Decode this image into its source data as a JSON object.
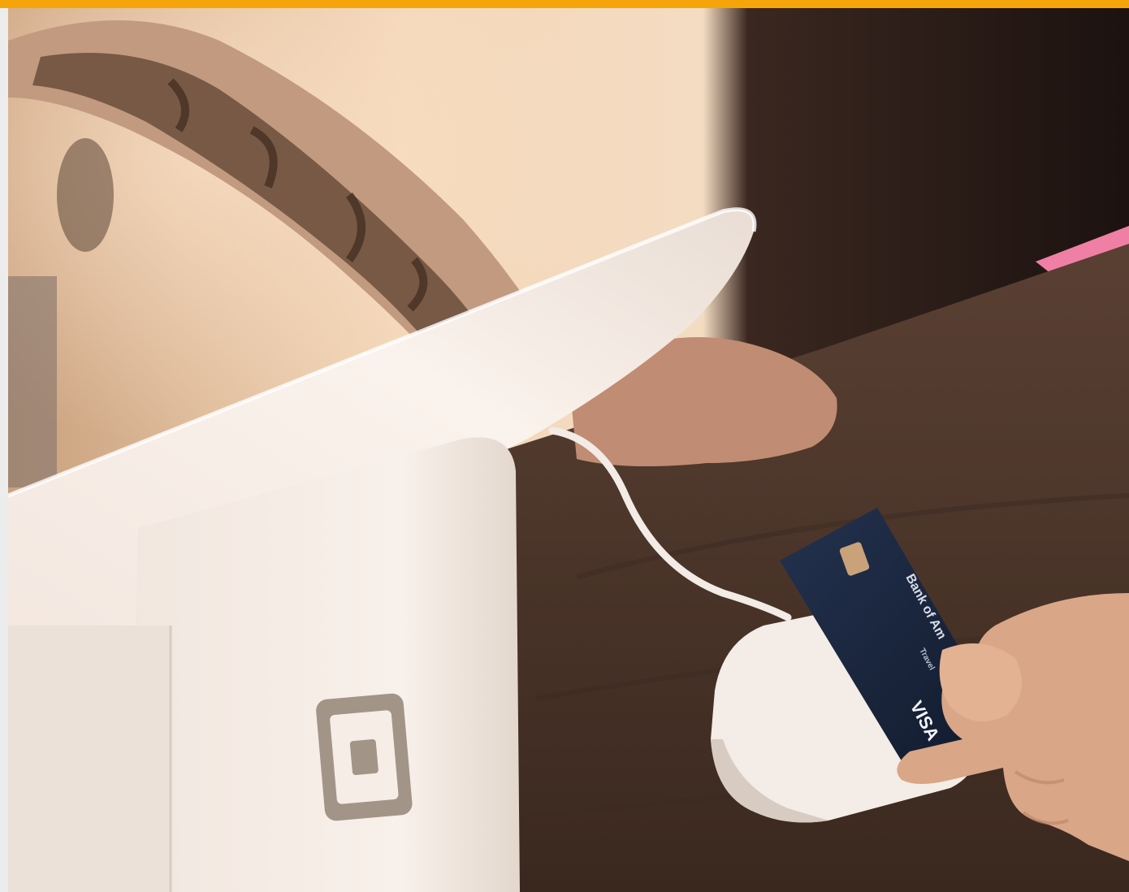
{
  "colors": {
    "accent": "#f5a50a",
    "border": "#ececec",
    "wall_warm": "#f1d3b4",
    "wall_shadow": "#bf9777",
    "dark_right": "#221713",
    "counter_wood": "#4a3429",
    "device_white": "#f6eee8",
    "device_shade": "#e4d9d1",
    "card_navy": "#1c2840",
    "skin": "#d9a687",
    "tattoo_sleeve": "#8a6650",
    "pink_paper": "#f07fa6"
  },
  "photo": {
    "card": {
      "bank_text": "Bank of Am",
      "sub_text": "Travel",
      "brand": "VISA"
    }
  },
  "icons": [
    "square-logo-icon",
    "emv-chip-icon"
  ]
}
